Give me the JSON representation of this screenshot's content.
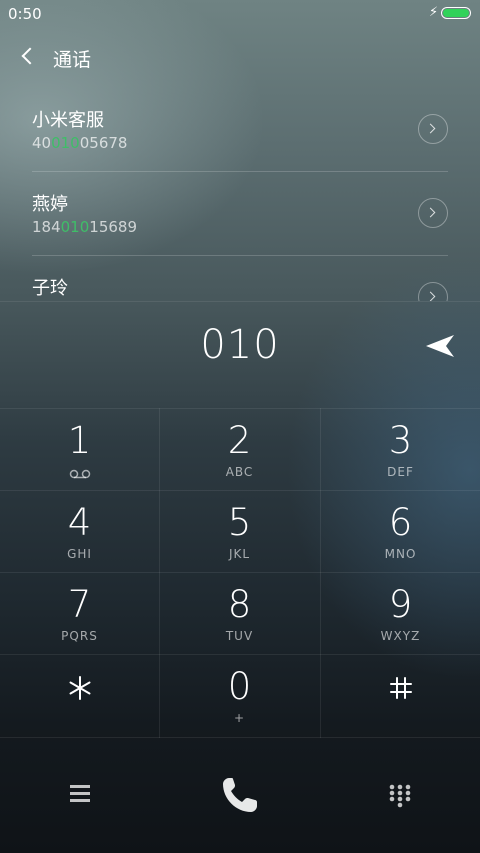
{
  "status": {
    "time": "0:50"
  },
  "header": {
    "title": "通话"
  },
  "results": [
    {
      "name": "小米客服",
      "number_pre": "40",
      "number_hl": "010",
      "number_post": "05678"
    },
    {
      "name": "燕婷",
      "number_pre": "184",
      "number_hl": "010",
      "number_post": "15689"
    },
    {
      "name": "子玲",
      "number_pre": "",
      "number_hl": "",
      "number_post": ""
    }
  ],
  "dial": {
    "number": "010"
  },
  "keypad": [
    {
      "digit": "1",
      "letters": ""
    },
    {
      "digit": "2",
      "letters": "ABC"
    },
    {
      "digit": "3",
      "letters": "DEF"
    },
    {
      "digit": "4",
      "letters": "GHI"
    },
    {
      "digit": "5",
      "letters": "JKL"
    },
    {
      "digit": "6",
      "letters": "MNO"
    },
    {
      "digit": "7",
      "letters": "PQRS"
    },
    {
      "digit": "8",
      "letters": "TUV"
    },
    {
      "digit": "9",
      "letters": "WXYZ"
    },
    {
      "digit": "*",
      "letters": ""
    },
    {
      "digit": "0",
      "letters": "+"
    },
    {
      "digit": "#",
      "letters": ""
    }
  ],
  "colors": {
    "highlight": "#3fbe68",
    "battery": "#31d25a"
  },
  "icons": [
    "back-icon",
    "chevron-right-icon",
    "send-icon",
    "voicemail-icon",
    "menu-icon",
    "phone-icon",
    "dialpad-icon",
    "charging-icon",
    "battery-icon"
  ]
}
